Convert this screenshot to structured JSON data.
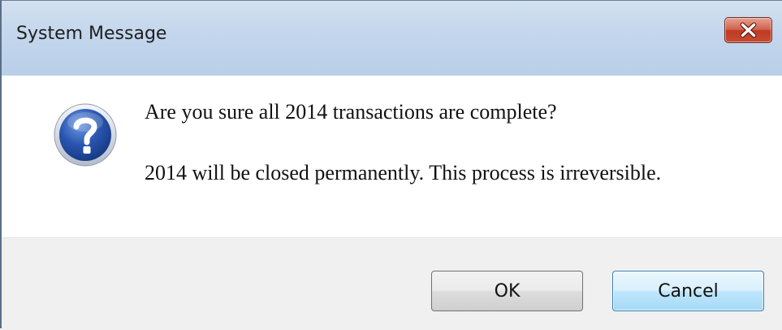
{
  "window": {
    "title": "System Message",
    "close_icon": "close-icon"
  },
  "message": {
    "icon": "question-icon",
    "line1": "Are you sure all 2014 transactions are complete?",
    "line2": "2014 will be closed permanently.  This process is irreversible."
  },
  "buttons": {
    "ok_label": "OK",
    "cancel_label": "Cancel"
  },
  "colors": {
    "titlebar": "#c3d6ec",
    "close_button": "#c74c33",
    "footer": "#f0f0f0",
    "icon_blue": "#2a56b0"
  }
}
